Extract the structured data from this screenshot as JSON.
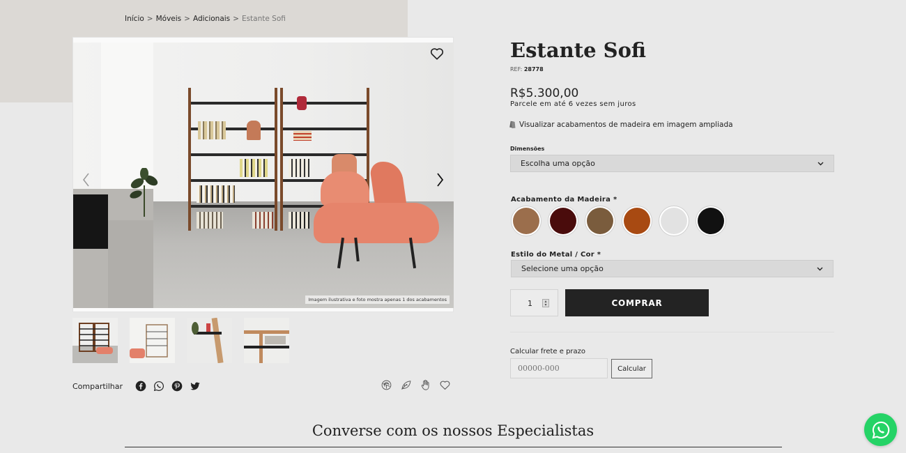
{
  "breadcrumb": {
    "items": [
      "Início",
      "Móveis",
      "Adicionais"
    ],
    "current": "Estante Sofi",
    "separator": ">"
  },
  "gallery": {
    "caption": "Imagem ilustrativa e foto mostra apenas 1 dos acabamentos",
    "thumbnail_count": 4
  },
  "share": {
    "label": "Compartilhar",
    "icons": [
      "facebook-icon",
      "whatsapp-icon",
      "pinterest-icon",
      "twitter-icon"
    ]
  },
  "features": {
    "icons": [
      "fingerprint-icon",
      "leaf-icon",
      "hand-icon",
      "heart-icon"
    ]
  },
  "product": {
    "title": "Estante Sofi",
    "ref_label": "REF:",
    "ref_value": "28778",
    "price": "R$5.300,00",
    "installments": "Parcele em até 6 vezes sem juros",
    "view_finish": "Visualizar acabamentos de madeira em imagem ampliada"
  },
  "options": {
    "dimensions_label": "Dimensões",
    "dimensions_value": "Escolha uma opção",
    "finish_label": "Acabamento da Madeira *",
    "finish_colors": [
      "#9b6e4c",
      "#4a0c0c",
      "#7a5c3d",
      "#a84a12",
      "#e2e2e2",
      "#111111"
    ],
    "metal_label": "Estilo do Metal / Cor *",
    "metal_value": "Selecione uma opção"
  },
  "cart": {
    "quantity": "1",
    "buy_label": "COMPRAR"
  },
  "shipping": {
    "label": "Calcular frete e prazo",
    "placeholder": "00000-000",
    "button": "Calcular"
  },
  "section": {
    "title": "Converse com os nossos Especialistas"
  },
  "colors": {
    "accent": "#232323",
    "whatsapp": "#25d366",
    "background": "#e9e9e9"
  }
}
